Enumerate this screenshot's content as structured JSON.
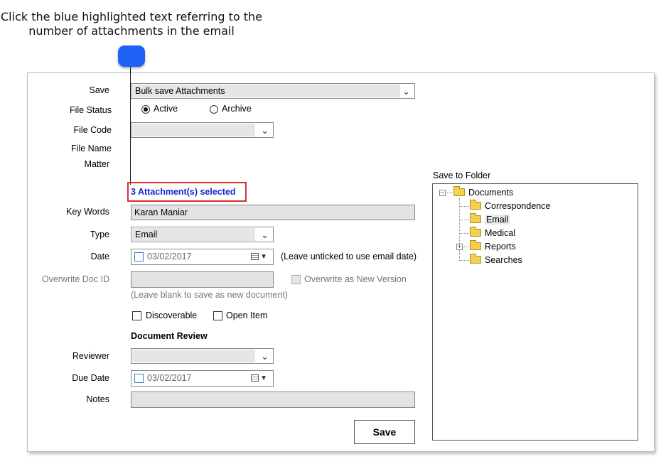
{
  "callout": {
    "line1": "Click the blue highlighted text referring to the",
    "line2": "number of attachments in the email"
  },
  "form": {
    "save_label": "Save",
    "save_value": "Bulk save Attachments",
    "file_status_label": "File Status",
    "status_active": "Active",
    "status_archive": "Archive",
    "status_selected": "Active",
    "file_code_label": "File Code",
    "file_code_value": "",
    "file_name_label": "File Name",
    "matter_label": "Matter",
    "attachments_link": "3 Attachment(s) selected",
    "key_words_label": "Key Words",
    "key_words_value": "Karan Maniar",
    "type_label": "Type",
    "type_value": "Email",
    "date_label": "Date",
    "date_value": "03/02/2017",
    "date_hint": "(Leave unticked to use email date)",
    "overwrite_label": "Overwrite Doc ID",
    "overwrite_value": "",
    "overwrite_version_label": "Overwrite as New Version",
    "overwrite_hint": "(Leave blank to save as new document)",
    "discoverable_label": "Discoverable",
    "open_item_label": "Open Item",
    "review_heading": "Document Review",
    "reviewer_label": "Reviewer",
    "reviewer_value": "",
    "due_date_label": "Due Date",
    "due_date_value": "03/02/2017",
    "notes_label": "Notes",
    "notes_value": "",
    "save_button": "Save"
  },
  "folder_tree": {
    "title": "Save to Folder",
    "root": "Documents",
    "children": [
      "Correspondence",
      "Email",
      "Medical",
      "Reports",
      "Searches"
    ],
    "selected": "Email"
  }
}
